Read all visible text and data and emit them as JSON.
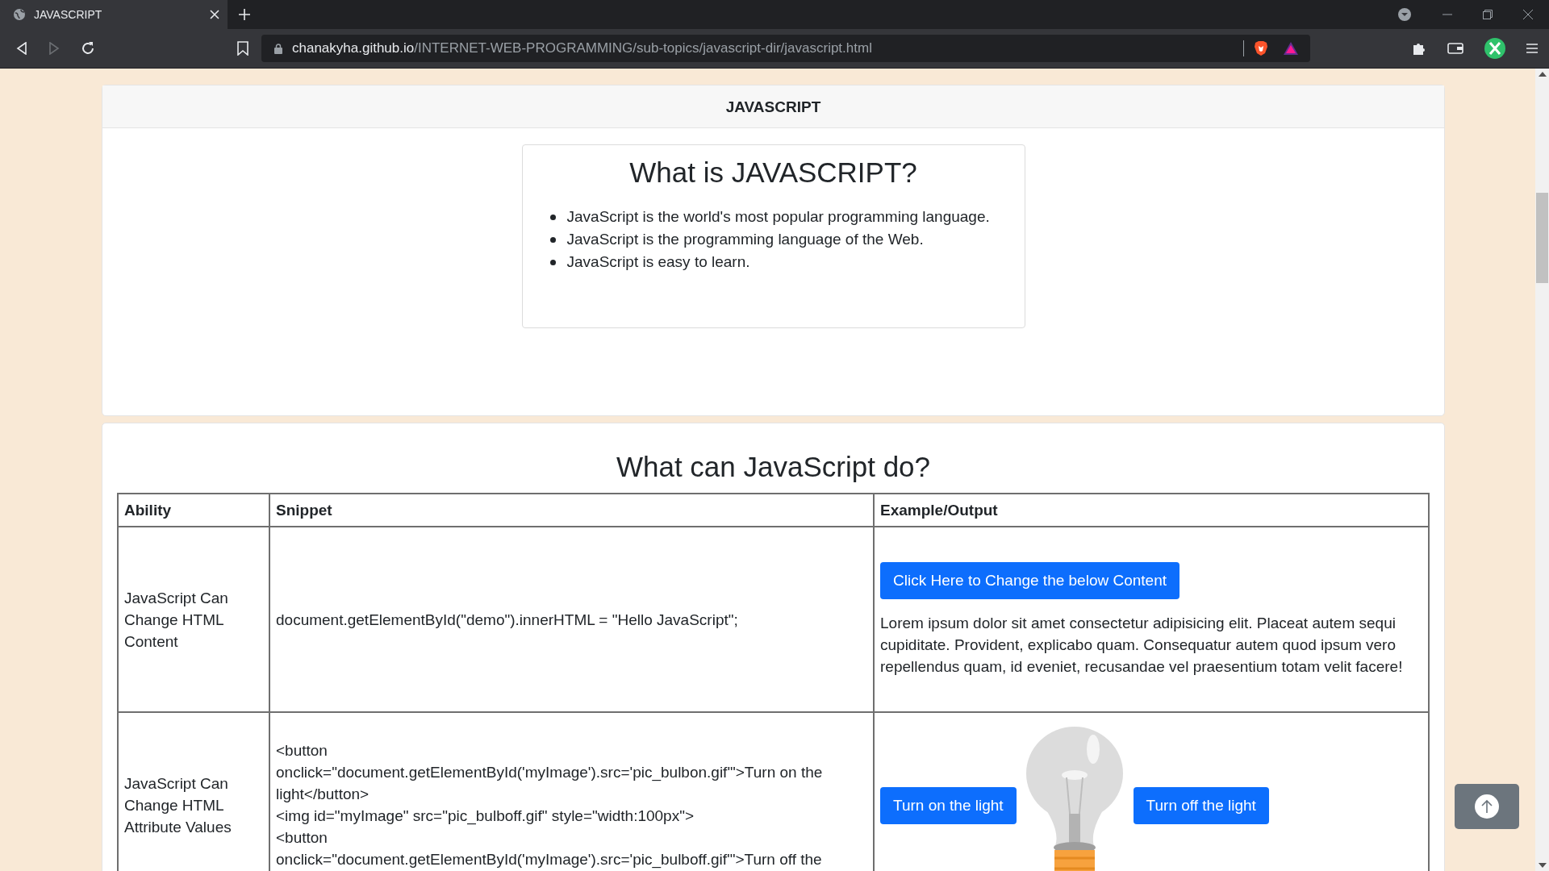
{
  "browser": {
    "tab": {
      "title": "JAVASCRIPT",
      "selected": true
    },
    "address": {
      "domain": "chanakyha.github.io",
      "path": "/INTERNET-WEB-PROGRAMMING/sub-topics/javascript-dir/javascript.html"
    },
    "forward_disabled": true
  },
  "page_header": "JAVASCRIPT",
  "intro": {
    "title": "What is JAVASCRIPT?",
    "bullets": [
      "JavaScript is the world's most popular programming language.",
      "JavaScript is the programming language of the Web.",
      "JavaScript is easy to learn."
    ]
  },
  "section": {
    "title": "What can JavaScript do?",
    "table": {
      "columns": [
        "Ability",
        "Snippet",
        "Example/Output"
      ],
      "rows": [
        {
          "ability": "JavaScript Can Change HTML Content",
          "snippet": [
            "document.getElementById(\"demo\").innerHTML = \"Hello JavaScript\";"
          ],
          "output": {
            "kind": "content",
            "button": "Click Here to Change the below Content",
            "text": "Lorem ipsum dolor sit amet consectetur adipisicing elit. Placeat autem sequi cupiditate. Provident, explicabo quam. Consequatur autem quod ipsum vero repellendus quam, id eveniet, recusandae vel praesentium totam velit facere!"
          }
        },
        {
          "ability": "JavaScript Can Change HTML Attribute Values",
          "snippet": [
            "<button",
            "onclick=\"document.getElementById('myImage').src='pic_bulbon.gif'\">Turn on the light</button>",
            "<img id=\"myImage\" src=\"pic_bulboff.gif\" style=\"width:100px\">",
            "<button",
            "onclick=\"document.getElementById('myImage').src='pic_bulboff.gif'\">Turn off the"
          ],
          "output": {
            "kind": "bulb",
            "buttons": [
              "Turn on the light",
              "Turn off the light"
            ]
          }
        }
      ]
    }
  }
}
